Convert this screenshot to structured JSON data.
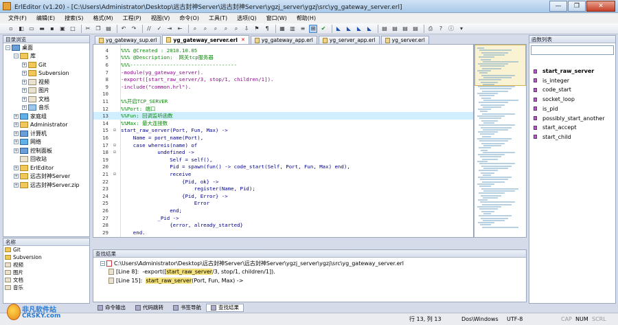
{
  "window": {
    "title": "ErlEditor (v1.20) - [C:\\Users\\Administrator\\Desktop\\远古封神Server\\远古封神Server\\ygzj_server\\ygzj\\src\\yg_gateway_server.erl]",
    "minimize": "—",
    "maximize": "❐",
    "close": "✕"
  },
  "menu": [
    "文件(F)",
    "编辑(E)",
    "搜索(S)",
    "格式(M)",
    "工程(P)",
    "视图(V)",
    "命令(O)",
    "工具(T)",
    "选项(Q)",
    "窗口(W)",
    "帮助(H)"
  ],
  "left_panel": {
    "title": "目录浏览",
    "tree": [
      {
        "label": "桌面",
        "level": 0,
        "exp": "−",
        "icon": "blue"
      },
      {
        "label": "库",
        "level": 1,
        "exp": "−",
        "icon": "folder"
      },
      {
        "label": "Git",
        "level": 2,
        "exp": "+",
        "icon": "folder"
      },
      {
        "label": "Subversion",
        "level": 2,
        "exp": "+",
        "icon": "folder"
      },
      {
        "label": "视频",
        "level": 2,
        "exp": "+",
        "icon": "file"
      },
      {
        "label": "图片",
        "level": 2,
        "exp": "+",
        "icon": "file"
      },
      {
        "label": "文档",
        "level": 2,
        "exp": "+",
        "icon": "file"
      },
      {
        "label": "音乐",
        "level": 2,
        "exp": "+",
        "icon": "music"
      },
      {
        "label": "家庭组",
        "level": 1,
        "exp": "+",
        "icon": "net"
      },
      {
        "label": "Administrator",
        "level": 1,
        "exp": "+",
        "icon": "folder"
      },
      {
        "label": "计算机",
        "level": 1,
        "exp": "+",
        "icon": "blue"
      },
      {
        "label": "网络",
        "level": 1,
        "exp": "+",
        "icon": "net"
      },
      {
        "label": "控制面板",
        "level": 1,
        "exp": "+",
        "icon": "blue"
      },
      {
        "label": "回收站",
        "level": 1,
        "exp": "",
        "icon": "file"
      },
      {
        "label": "ErlEditor",
        "level": 1,
        "exp": "+",
        "icon": "folder"
      },
      {
        "label": "远古封神Server",
        "level": 1,
        "exp": "+",
        "icon": "folder"
      },
      {
        "label": "远古封神Server.zip",
        "level": 1,
        "exp": "+",
        "icon": "folder"
      }
    ],
    "names_title": "名称",
    "names": [
      "Git",
      "Subversion",
      "视频",
      "图片",
      "文档",
      "音乐"
    ]
  },
  "tabs": [
    {
      "label": "yg_gateway_sup.erl",
      "active": false
    },
    {
      "label": "yg_gateway_server.erl",
      "active": true
    },
    {
      "label": "yg_gateway_app.erl",
      "active": false
    },
    {
      "label": "yg_server_app.erl",
      "active": false
    },
    {
      "label": "yg_server.erl",
      "active": false
    }
  ],
  "tab_close": "✕",
  "editor": {
    "lines": [
      {
        "n": "4",
        "fold": "",
        "text": "%%% @Created : 2010.10.05",
        "color": "#0a8a0a"
      },
      {
        "n": "5",
        "fold": "",
        "text": "%%% @Description:  网关tcp服务器",
        "color": "#0a8a0a"
      },
      {
        "n": "6",
        "fold": "",
        "text": "%%%-----------------------------------",
        "color": "#0a8a0a"
      },
      {
        "n": "7",
        "fold": "",
        "text": "-module(yg_gateway_server).",
        "color": "#8a0a8a"
      },
      {
        "n": "8",
        "fold": "",
        "text": "-export([start_raw_server/3, stop/1, children/1]).",
        "color": "#8a0a8a"
      },
      {
        "n": "9",
        "fold": "",
        "text": "-include(\"common.hrl\").",
        "color": "#8a0a8a"
      },
      {
        "n": "10",
        "fold": "",
        "text": "",
        "color": "#000"
      },
      {
        "n": "11",
        "fold": "",
        "text": "%%开启TCP_SERVER",
        "color": "#0a8a0a"
      },
      {
        "n": "12",
        "fold": "",
        "text": "%%Port: 端口",
        "color": "#0a8a0a"
      },
      {
        "n": "13",
        "fold": "",
        "text": "%%Fun: 回调监听函数",
        "color": "#0a8a0a",
        "hl": true
      },
      {
        "n": "14",
        "fold": "",
        "text": "%%Max: 最大连接数",
        "color": "#0a8a0a"
      },
      {
        "n": "15",
        "fold": "⊟",
        "text": "start_raw_server(Port, Fun, Max) ->",
        "color": "#00008b"
      },
      {
        "n": "16",
        "fold": "",
        "text": "    Name = port_name(Port),",
        "color": "#00008b"
      },
      {
        "n": "17",
        "fold": "⊟",
        "text": "    case whereis(name) of",
        "color": "#00008b"
      },
      {
        "n": "18",
        "fold": "⊟",
        "text": "            undefined ->",
        "color": "#00008b"
      },
      {
        "n": "19",
        "fold": "",
        "text": "                Self = self(),",
        "color": "#00008b"
      },
      {
        "n": "20",
        "fold": "",
        "text": "                Pid = spawn(fun() -> code_start(Self, Port, Fun, Max) end),",
        "color": "#00008b"
      },
      {
        "n": "21",
        "fold": "⊟",
        "text": "                receive",
        "color": "#00008b"
      },
      {
        "n": "22",
        "fold": "",
        "text": "                    {Pid, ok} ->",
        "color": "#00008b"
      },
      {
        "n": "23",
        "fold": "",
        "text": "                        register(Name, Pid);",
        "color": "#00008b"
      },
      {
        "n": "24",
        "fold": "",
        "text": "                    {Pid, Error} ->",
        "color": "#00008b"
      },
      {
        "n": "25",
        "fold": "",
        "text": "                        Error",
        "color": "#00008b"
      },
      {
        "n": "26",
        "fold": "",
        "text": "                end;",
        "color": "#00008b"
      },
      {
        "n": "27",
        "fold": "",
        "text": "            _Pid ->",
        "color": "#00008b"
      },
      {
        "n": "28",
        "fold": "",
        "text": "                {error, already_started}",
        "color": "#00008b"
      },
      {
        "n": "29",
        "fold": "",
        "text": "    end.",
        "color": "#00008b"
      }
    ]
  },
  "right_panel": {
    "title": "函数列表",
    "functions": [
      "start_raw_server",
      "is_integer",
      "code_start",
      "socket_loop",
      "is_pid",
      "possibly_start_another",
      "start_accept",
      "start_child"
    ]
  },
  "find": {
    "title": "查找结果",
    "file": "C:\\Users\\Administrator\\Desktop\\远古封神Server\\远古封神Server\\ygzj_server\\ygzj\\src\\yg_gateway_server.erl",
    "results": [
      {
        "line": "[Line 8]:",
        "pre": "-export([",
        "match": "start_raw_server",
        "post": "/3, stop/1, children/1])."
      },
      {
        "line": "[Line 15]:",
        "pre": "",
        "match": "start_raw_server",
        "post": "(Port, Fun, Max) ->"
      }
    ]
  },
  "bottom_tabs": [
    "命令输出",
    "代码跳转",
    "书签导航",
    "查找结果"
  ],
  "status": {
    "position": "行 13, 列 13",
    "eol": "Dos\\Windows",
    "encoding": "UTF-8",
    "cap": "CAP",
    "num": "NUM",
    "scrl": "SCRL"
  },
  "watermark": {
    "brand": "非凡软件站",
    "site": "CRSKY.com"
  }
}
